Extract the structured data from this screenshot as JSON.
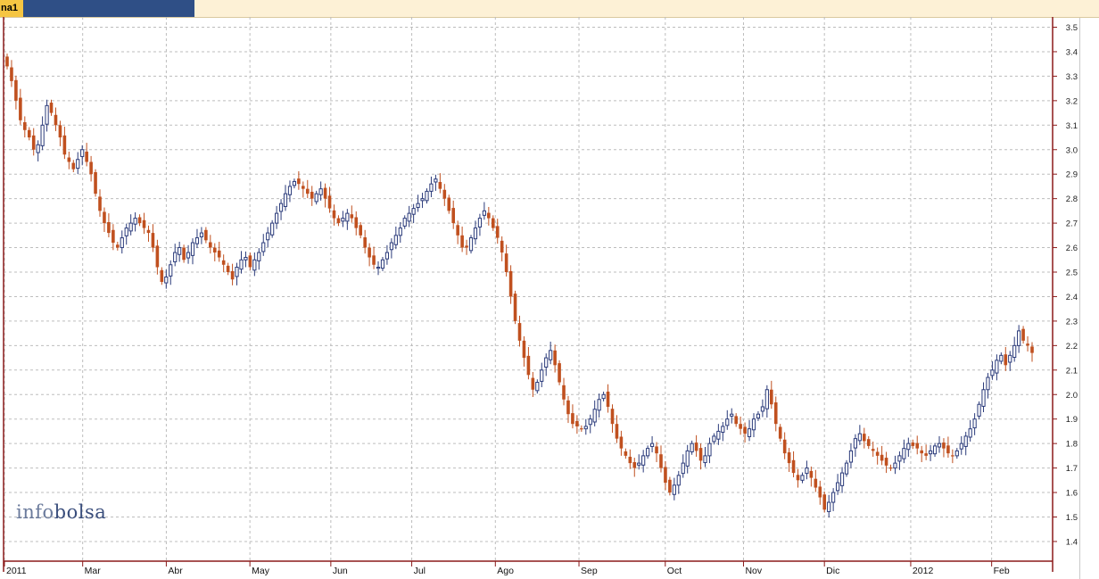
{
  "window": {
    "tab_label": "na1"
  },
  "watermark": {
    "part1": "info",
    "part2": "bolsa"
  },
  "colors": {
    "up": "#2a3a7a",
    "down": "#c0501f",
    "axis": "#8b1a1a",
    "grid": "#bdbdbd"
  },
  "chart_data": {
    "type": "candlestick",
    "title": "",
    "xlabel": "",
    "ylabel": "",
    "ylim": [
      1.35,
      3.55
    ],
    "y_ticks": [
      1.4,
      1.5,
      1.6,
      1.7,
      1.8,
      1.9,
      2.0,
      2.1,
      2.2,
      2.3,
      2.4,
      2.5,
      2.6,
      2.7,
      2.8,
      2.9,
      3.0,
      3.1,
      3.2,
      3.3,
      3.4,
      3.5
    ],
    "x_ticks": [
      "2011",
      "Mar",
      "Abr",
      "May",
      "Jun",
      "Jul",
      "Ago",
      "Sep",
      "Oct",
      "Nov",
      "Dic",
      "2012",
      "Feb"
    ],
    "x_tick_dates": [
      "2011-01-31",
      "2011-03-01",
      "2011-04-01",
      "2011-05-02",
      "2011-06-01",
      "2011-07-01",
      "2011-08-01",
      "2011-09-01",
      "2011-10-03",
      "2011-11-01",
      "2011-12-01",
      "2012-01-02",
      "2012-02-01"
    ],
    "date_range": [
      "2011-01-31",
      "2012-02-16"
    ],
    "grid": true,
    "closes": [
      3.34,
      3.28,
      3.2,
      3.12,
      3.08,
      3.05,
      3.0,
      3.02,
      3.1,
      3.18,
      3.15,
      3.1,
      3.05,
      2.98,
      2.95,
      2.92,
      2.96,
      3.0,
      2.95,
      2.9,
      2.82,
      2.75,
      2.7,
      2.66,
      2.62,
      2.6,
      2.64,
      2.68,
      2.7,
      2.72,
      2.7,
      2.68,
      2.66,
      2.6,
      2.52,
      2.46,
      2.48,
      2.53,
      2.58,
      2.6,
      2.55,
      2.58,
      2.62,
      2.64,
      2.66,
      2.63,
      2.6,
      2.58,
      2.56,
      2.53,
      2.5,
      2.47,
      2.52,
      2.55,
      2.56,
      2.52,
      2.55,
      2.58,
      2.62,
      2.66,
      2.7,
      2.74,
      2.78,
      2.82,
      2.85,
      2.87,
      2.86,
      2.84,
      2.82,
      2.8,
      2.82,
      2.84,
      2.8,
      2.76,
      2.72,
      2.7,
      2.72,
      2.74,
      2.72,
      2.68,
      2.65,
      2.6,
      2.56,
      2.53,
      2.52,
      2.55,
      2.58,
      2.62,
      2.65,
      2.68,
      2.72,
      2.74,
      2.76,
      2.78,
      2.8,
      2.83,
      2.86,
      2.88,
      2.84,
      2.8,
      2.75,
      2.7,
      2.65,
      2.6,
      2.6,
      2.64,
      2.68,
      2.72,
      2.75,
      2.72,
      2.68,
      2.64,
      2.58,
      2.5,
      2.4,
      2.3,
      2.22,
      2.15,
      2.08,
      2.02,
      2.05,
      2.1,
      2.15,
      2.18,
      2.12,
      2.05,
      1.98,
      1.92,
      1.88,
      1.87,
      1.86,
      1.87,
      1.9,
      1.94,
      1.98,
      2.0,
      1.95,
      1.88,
      1.82,
      1.78,
      1.75,
      1.72,
      1.7,
      1.72,
      1.75,
      1.78,
      1.8,
      1.76,
      1.7,
      1.64,
      1.6,
      1.63,
      1.67,
      1.72,
      1.77,
      1.8,
      1.77,
      1.73,
      1.75,
      1.8,
      1.83,
      1.85,
      1.87,
      1.9,
      1.92,
      1.88,
      1.86,
      1.84,
      1.86,
      1.9,
      1.92,
      1.95,
      2.02,
      1.96,
      1.88,
      1.82,
      1.76,
      1.72,
      1.68,
      1.65,
      1.67,
      1.7,
      1.66,
      1.62,
      1.58,
      1.53,
      1.56,
      1.6,
      1.64,
      1.68,
      1.72,
      1.77,
      1.82,
      1.84,
      1.81,
      1.79,
      1.77,
      1.75,
      1.73,
      1.71,
      1.7,
      1.72,
      1.75,
      1.78,
      1.8,
      1.79,
      1.78,
      1.76,
      1.75,
      1.77,
      1.79,
      1.8,
      1.78,
      1.76,
      1.75,
      1.77,
      1.8,
      1.83,
      1.86,
      1.9,
      1.96,
      2.02,
      2.07,
      2.1,
      2.14,
      2.16,
      2.12,
      2.16,
      2.2,
      2.26,
      2.22,
      2.2,
      2.17
    ]
  }
}
